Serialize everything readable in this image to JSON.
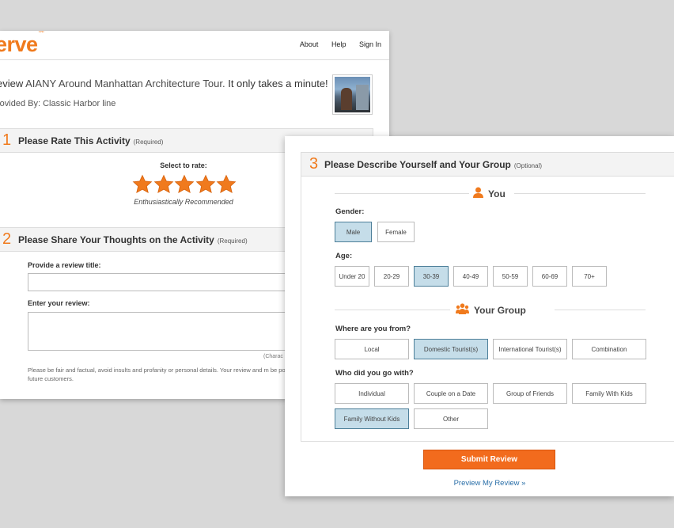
{
  "brand": {
    "logo": "erve",
    "tm": "TM"
  },
  "nav": {
    "about": "About",
    "help": "Help",
    "signin": "Sign In"
  },
  "intro": {
    "prefix": "eview ",
    "activity": "AIANY Around Manhattan Architecture Tour.",
    "suffix": " It only takes a minute!",
    "provided": "rovided By: Classic Harbor line"
  },
  "section1": {
    "num": "1",
    "title": "Please Rate This Activity",
    "req": "(Required)",
    "select_label": "Select to rate:",
    "rating": 5,
    "caption": "Enthusiastically Recommended"
  },
  "section2": {
    "num": "2",
    "title": "Please Share Your Thoughts on the Activity",
    "req": "(Required)",
    "title_label": "Provide a review title:",
    "review_label": "Enter your review:",
    "char_note": "(Charac",
    "fine_print": "Please be fair and factual, avoid insults and profanity or personal details. Your review and m be posted on our site to help future customers."
  },
  "section3": {
    "num": "3",
    "title": "Please Describe Yourself and Your Group",
    "req": "(Optional)",
    "you_title": "You",
    "gender_label": "Gender:",
    "genders": [
      "Male",
      "Female"
    ],
    "age_label": "Age:",
    "ages": [
      "Under 20",
      "20-29",
      "30-39",
      "40-49",
      "50-59",
      "60-69",
      "70+"
    ],
    "group_title": "Your Group",
    "from_label": "Where are you from?",
    "from": [
      "Local",
      "Domestic Tourist(s)",
      "International Tourist(s)",
      "Combination"
    ],
    "with_label": "Who did you go with?",
    "with": [
      "Individual",
      "Couple on a Date",
      "Group of Friends",
      "Family With Kids",
      "Family Without Kids",
      "Other"
    ],
    "selected": {
      "gender": "Male",
      "age": "30-39",
      "from": "Domestic Tourist(s)",
      "with": "Family Without Kids"
    }
  },
  "actions": {
    "submit": "Submit Review",
    "preview": "Preview My Review »"
  },
  "colors": {
    "accent": "#f07a1d",
    "selected": "#c5dde9",
    "link": "#2a6fa8"
  }
}
